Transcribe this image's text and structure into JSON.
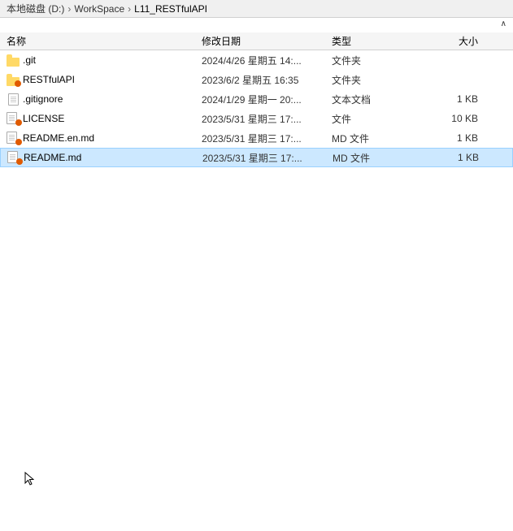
{
  "breadcrumb": {
    "items": [
      {
        "label": "本地磁盘 (D:)",
        "separator": "›"
      },
      {
        "label": "WorkSpace",
        "separator": "›"
      },
      {
        "label": "L11_RESTfulAPI",
        "separator": ""
      }
    ]
  },
  "sort": {
    "arrow": "∧"
  },
  "columns": {
    "name": "名称",
    "date": "修改日期",
    "type": "类型",
    "size": "大小"
  },
  "files": [
    {
      "name": ".git",
      "date": "2024/4/26 星期五 14:...",
      "type": "文件夹",
      "size": "",
      "icon": "git-folder",
      "selected": false
    },
    {
      "name": "RESTfulAPI",
      "date": "2023/6/2 星期五 16:35",
      "type": "文件夹",
      "size": "",
      "icon": "restful-folder",
      "selected": false
    },
    {
      "name": ".gitignore",
      "date": "2024/1/29 星期一 20:...",
      "type": "文本文档",
      "size": "1 KB",
      "icon": "text-doc",
      "selected": false
    },
    {
      "name": "LICENSE",
      "date": "2023/5/31 星期三 17:...",
      "type": "文件",
      "size": "10 KB",
      "icon": "license-file",
      "selected": false
    },
    {
      "name": "README.en.md",
      "date": "2023/5/31 星期三 17:...",
      "type": "MD 文件",
      "size": "1 KB",
      "icon": "md-file",
      "selected": false
    },
    {
      "name": "README.md",
      "date": "2023/5/31 星期三 17:...",
      "type": "MD 文件",
      "size": "1 KB",
      "icon": "md-file",
      "selected": true
    }
  ]
}
